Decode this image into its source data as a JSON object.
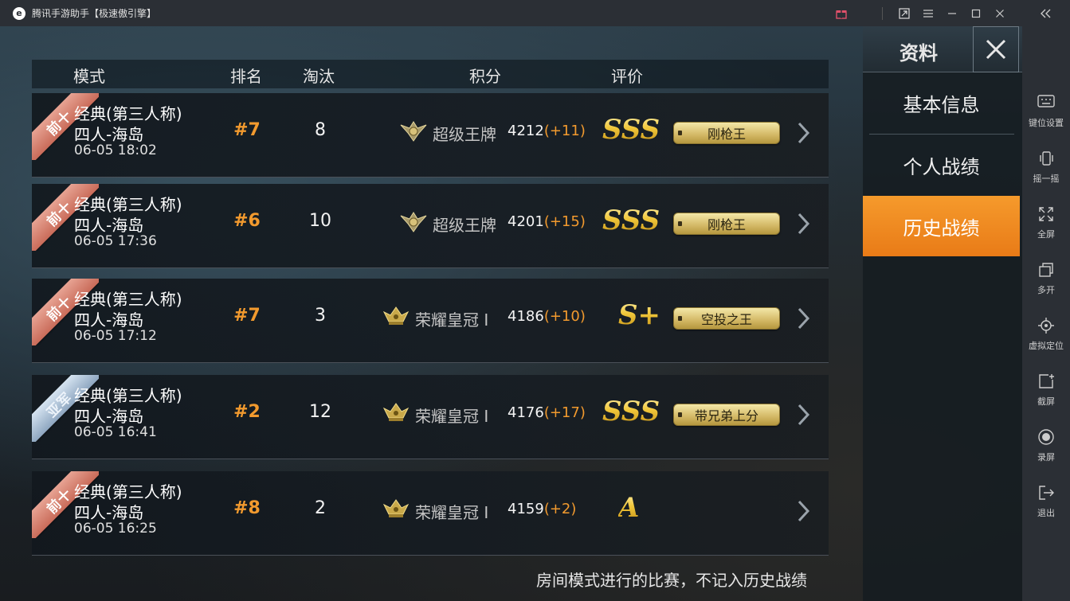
{
  "window": {
    "title": "腾讯手游助手【极速傲引擎】",
    "controls": [
      "gift-icon",
      "pin-icon",
      "menu-icon",
      "minimize-icon",
      "maximize-icon",
      "close-icon"
    ]
  },
  "sidebar": {
    "tools": [
      {
        "icon": "keyboard-icon",
        "label": "键位设置"
      },
      {
        "icon": "shake-icon",
        "label": "摇一摇"
      },
      {
        "icon": "fullscreen-icon",
        "label": "全屏"
      },
      {
        "icon": "multi-open-icon",
        "label": "多开"
      },
      {
        "icon": "location-icon",
        "label": "虚拟定位"
      },
      {
        "icon": "screenshot-icon",
        "label": "截屏"
      },
      {
        "icon": "record-icon",
        "label": "录屏"
      },
      {
        "icon": "exit-icon",
        "label": "退出"
      }
    ]
  },
  "table": {
    "headers": {
      "mode": "模式",
      "rank": "排名",
      "kills": "淘汰",
      "score": "积分",
      "rating": "评价"
    },
    "rows": [
      {
        "badge": "前十",
        "mode_line1": "经典(第三人称)",
        "mode_line2": "四人-海岛",
        "time": "06-05 18:02",
        "rank": "#7",
        "kills": "8",
        "tier": "超级王牌",
        "score": "4212",
        "delta": "(+11)",
        "grade": "SSS",
        "title": "刚枪王"
      },
      {
        "badge": "前十",
        "mode_line1": "经典(第三人称)",
        "mode_line2": "四人-海岛",
        "time": "06-05 17:36",
        "rank": "#6",
        "kills": "10",
        "tier": "超级王牌",
        "score": "4201",
        "delta": "(+15)",
        "grade": "SSS",
        "title": "刚枪王"
      },
      {
        "badge": "前十",
        "mode_line1": "经典(第三人称)",
        "mode_line2": "四人-海岛",
        "time": "06-05 17:12",
        "rank": "#7",
        "kills": "3",
        "tier": "荣耀皇冠 I",
        "score": "4186",
        "delta": "(+10)",
        "grade": "S+",
        "title": "空投之王"
      },
      {
        "badge": "亚军",
        "mode_line1": "经典(第三人称)",
        "mode_line2": "四人-海岛",
        "time": "06-05 16:41",
        "rank": "#2",
        "kills": "12",
        "tier": "荣耀皇冠 I",
        "score": "4176",
        "delta": "(+17)",
        "grade": "SSS",
        "title": "带兄弟上分"
      },
      {
        "badge": "前十",
        "mode_line1": "经典(第三人称)",
        "mode_line2": "四人-海岛",
        "time": "06-05 16:25",
        "rank": "#8",
        "kills": "2",
        "tier": "荣耀皇冠 I",
        "score": "4159",
        "delta": "(+2)",
        "grade": "A",
        "title": ""
      }
    ]
  },
  "footnote": "房间模式进行的比赛，不记入历史战绩",
  "panel": {
    "title": "资料",
    "menu": [
      {
        "label": "基本信息",
        "active": false
      },
      {
        "label": "个人战绩",
        "active": false
      },
      {
        "label": "历史战绩",
        "active": true
      }
    ]
  },
  "colors": {
    "accent": "#f29a2e",
    "active_tab": "#ef8a20",
    "badge_top10": "#d67b68",
    "badge_runner_up": "#a9bfd6"
  }
}
